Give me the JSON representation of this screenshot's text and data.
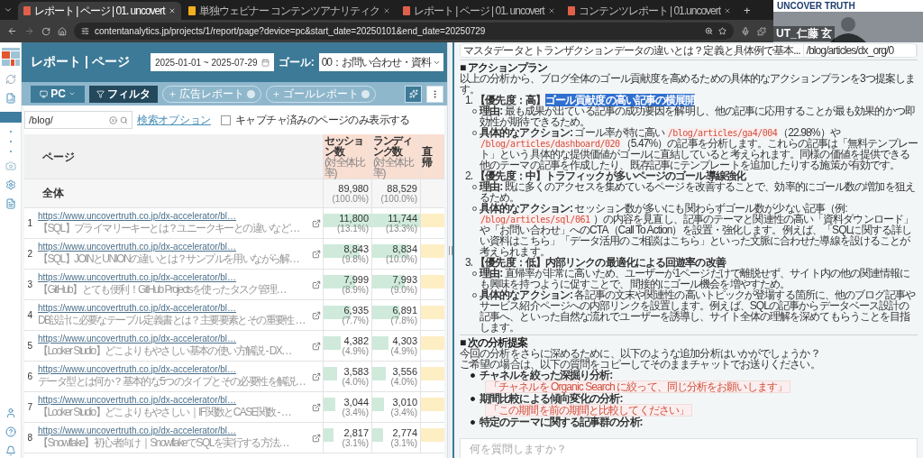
{
  "browser": {
    "tabs": [
      {
        "label": "レポート | ページ | 01. uncovert",
        "selected": true
      },
      {
        "label": "単独ウェビナー コンテンツアナリティク",
        "selected": false
      },
      {
        "label": "レポート | ページ | 01. uncovert",
        "selected": false
      },
      {
        "label": "コンテンツレポート | 01.uncovert",
        "selected": false
      }
    ],
    "new_tab": "+",
    "url": "contentanalytics.jp/projects/1/report/page?device=pc&start_date=20250101&end_date=20250729"
  },
  "report": {
    "title": "レポート | ページ",
    "date_range": "2025-01-01 ~ 2025-07-29",
    "goal_label": "ゴール:",
    "goal_value": "00：お問い合わせ・資料",
    "device": "PC",
    "filter": "フィルタ",
    "add_buttons": [
      "広告レポート",
      "ゴールレポート"
    ],
    "search": {
      "value": "/blog/"
    },
    "search_option": "検索オプション",
    "captured_only": {
      "label": "キャプチャ済みのページのみ表示する",
      "checked": false
    },
    "table": {
      "columns": [
        {
          "label": "ページ"
        },
        {
          "label": "セッション数",
          "sub": "(対全体比率)"
        },
        {
          "label": "ランディング数",
          "sub": "(対全体比率)"
        },
        {
          "label": "直帰"
        }
      ],
      "total": {
        "label": "全体",
        "sessions": {
          "value": "89,980",
          "share": "(100.0%)"
        },
        "landings": {
          "value": "88,529",
          "share": "(100.0%)"
        }
      },
      "rows": [
        {
          "rank": "1",
          "url": "https://www.uncovertruth.co.jp/dx-accelerator/bl…",
          "title": "【SQL】プライマリーキーとは？ユニークキーとの違いなど…",
          "sessions": {
            "value": "11,800",
            "share": "(13.1%)",
            "level": 1
          },
          "landings": {
            "value": "11,744",
            "share": "(13.3%)",
            "level": 1
          }
        },
        {
          "rank": "2",
          "url": "https://www.uncovertruth.co.jp/dx-accelerator/bl…",
          "title": "【SQL】JOINとUNIONの違いとは？サンプルを用いながら解…",
          "sessions": {
            "value": "8,843",
            "share": "(9.8%)",
            "level": 0.75
          },
          "landings": {
            "value": "8,834",
            "share": "(10.0%)",
            "level": 0.75
          }
        },
        {
          "rank": "3",
          "url": "https://www.uncovertruth.co.jp/dx-accelerator/bl…",
          "title": "【GitHub】とても便利！GitHub Projectsを使ったタスク管理…",
          "sessions": {
            "value": "7,999",
            "share": "(8.9%)",
            "level": 0.66
          },
          "landings": {
            "value": "7,993",
            "share": "(9.0%)",
            "level": 0.67
          }
        },
        {
          "rank": "4",
          "url": "https://www.uncovertruth.co.jp/dx-accelerator/bl…",
          "title": "DB設計に必要なテーブル定義書とは？主要要素とその重要性 …",
          "sessions": {
            "value": "6,935",
            "share": "(7.7%)",
            "level": 0.57
          },
          "landings": {
            "value": "6,891",
            "share": "(7.8%)",
            "level": 0.57
          }
        },
        {
          "rank": "5",
          "url": "https://www.uncovertruth.co.jp/dx-accelerator/bl…",
          "title": "【Looker Studio】どこよりもやさしい基本の使い方解説 - DX…",
          "sessions": {
            "value": "4,382",
            "share": "(4.9%)",
            "level": 0.35
          },
          "landings": {
            "value": "4,303",
            "share": "(4.9%)",
            "level": 0.34
          }
        },
        {
          "rank": "6",
          "url": "https://www.uncovertruth.co.jp/dx-accelerator/bl…",
          "title": "データ型とは何か？基本的な5つのタイプとその必要性を解説…",
          "sessions": {
            "value": "3,583",
            "share": "(4.0%)",
            "level": 0.28
          },
          "landings": {
            "value": "3,556",
            "share": "(4.0%)",
            "level": 0.28
          }
        },
        {
          "rank": "7",
          "url": "https://www.uncovertruth.co.jp/dx-accelerator/bl…",
          "title": "【Looker Studio】どこよりもやさしい｜IF関数とCASE関数 - …",
          "sessions": {
            "value": "3,044",
            "share": "(3.4%)",
            "level": 0.24
          },
          "landings": {
            "value": "3,010",
            "share": "(3.4%)",
            "level": 0.24
          }
        },
        {
          "rank": "8",
          "url": "https://www.uncovertruth.co.jp/dx-accelerator/bl…",
          "title": "【Snowflake】初心者向け｜SnowflakeでSQLを実行する方法…",
          "sessions": {
            "value": "2,817",
            "share": "(3.1%)",
            "level": 0.21
          },
          "landings": {
            "value": "2,774",
            "share": "(3.1%)",
            "level": 0.22
          }
        }
      ]
    }
  },
  "chat": {
    "prev_row": {
      "title": "マスタデータとトランザクションデータの違いとは？定義と具体例で基本...",
      "path": "/blog/articles/dx_org/0"
    },
    "action_plan": {
      "heading": "■ アクションプラン",
      "intro": "以上の分析から、ブログ全体のゴール貢献度を高めるための具体的なアクションプランを3つ提案します。",
      "plans": [
        {
          "number": "1.",
          "priority": "【優先度：高】",
          "title": "ゴール貢献度の高い記事の横展開",
          "highlighted": true,
          "points": [
            {
              "label": "理由:",
              "parts": [
                {
                  "kind": "text",
                  "text": "最も成果が出ている記事の成功要因を解明し、他の記事に応用することが最も効果的かつ即効性が期待できるため。"
                }
              ]
            },
            {
              "label": "具体的なアクション:",
              "parts": [
                {
                  "kind": "text",
                  "text": "ゴール率が特に高い "
                },
                {
                  "kind": "code",
                  "text": "/blog/articles/ga4/004"
                },
                {
                  "kind": "text",
                  "text": "（22.98%）や "
                },
                {
                  "kind": "code",
                  "text": "/blog/articles/dashboard/020"
                },
                {
                  "kind": "text",
                  "text": "（5.47%）の記事を分析します。これらの記事は「無料テンプレート」という具体的な提供価値がゴールに直結していると考えられます。同様の価値を提供できる他のテーマの記事を作成したり、既存記事にテンプレートを追加したりする施策が有効です。"
                }
              ]
            }
          ]
        },
        {
          "number": "2.",
          "priority": "【優先度：中】",
          "title": "トラフィックが多いページのゴール導線強化",
          "highlighted": false,
          "points": [
            {
              "label": "理由:",
              "parts": [
                {
                  "kind": "text",
                  "text": "既に多くのアクセスを集めているページを改善することで、効率的にゴール数の増加を狙えるため。"
                }
              ]
            },
            {
              "label": "具体的なアクション:",
              "parts": [
                {
                  "kind": "text",
                  "text": "セッション数が多いにも関わらずゴール数が少ない記事（例: "
                },
                {
                  "kind": "code",
                  "text": "/blog/articles/sql/061"
                },
                {
                  "kind": "text",
                  "text": " ）の内容を見直し、記事のテーマと関連性の高い「資料ダウンロード」や「お問い合わせ」へのCTA（Call To Action）を設置・強化します。例えば、「SQLに関する詳しい資料はこちら」「データ活用のご相談はこちら」といった文脈に合わせた導線を設けることが考えられます。"
                }
              ]
            }
          ]
        },
        {
          "number": "3.",
          "priority": "【優先度：低】",
          "title": "内部リンクの最適化による回遊率の改善",
          "highlighted": false,
          "points": [
            {
              "label": "理由:",
              "parts": [
                {
                  "kind": "text",
                  "text": "直帰率が非常に高いため、ユーザーが1ページだけで離脱せず、サイト内の他の関連情報にも興味を持つように促すことで、間接的にゴール機会を増やすため。"
                }
              ]
            },
            {
              "label": "具体的なアクション:",
              "parts": [
                {
                  "kind": "text",
                  "text": "各記事の文末や関連性の高いトピックが登場する箇所に、他のブログ記事やサービス紹介ページへの内部リンクを設置します。例えば、SQLの記事からデータベース設計の記事へ、といった自然な流れでユーザーを誘導し、サイト全体の理解を深めてもらうことを目指します。"
                }
              ]
            }
          ]
        }
      ]
    },
    "next_analysis": {
      "heading": "■ 次の分析提案",
      "intro": [
        "今回の分析をさらに深めるために、以下のような追加分析はいかがでしょうか？",
        "ご希望の場合は、以下の質問をコピーしてそのままチャットでお送りください。"
      ],
      "suggestions": [
        {
          "label": "チャネルを絞った深掘り分析:",
          "quote": "「チャネルを Organic Search に絞って、同じ分析をお願いします」"
        },
        {
          "label": "期間比較による傾向変化の分析:",
          "quote": "「この期間を前の期間と比較してください」"
        },
        {
          "label": "特定のテーマに関する記事群の分析:"
        }
      ]
    },
    "input": {
      "placeholder": "何を質問しますか？"
    }
  },
  "video": {
    "logo": "UNCOVER TRUTH",
    "name": "UT_仁藤 玄"
  }
}
